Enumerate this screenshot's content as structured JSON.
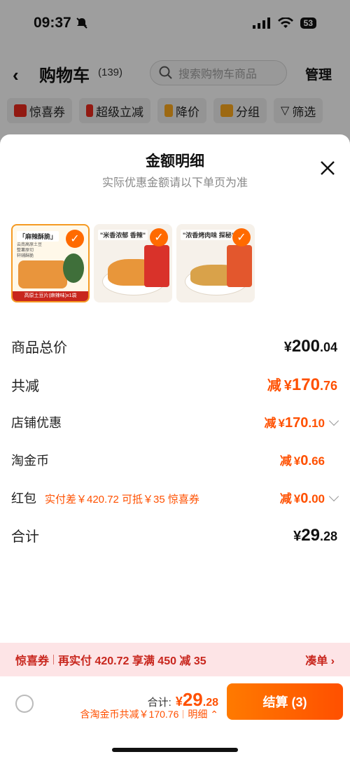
{
  "status": {
    "time": "09:37",
    "battery": "53"
  },
  "header": {
    "title": "购物车",
    "count": "(139)",
    "search_placeholder": "搜索购物车商品",
    "manage": "管理"
  },
  "chips": [
    "惊喜券",
    "超级立减",
    "降价",
    "分组",
    "筛选"
  ],
  "sheet": {
    "title": "金额明细",
    "subtitle": "实际优惠金额请以下单页为准",
    "products": [
      {
        "name": "「麻辣酥脆」",
        "line1": "云南高原土豆",
        "line2": "整薯原切",
        "line3": "轩辅酥脆",
        "bar": "高原土豆片(麻辣味)x1袋"
      },
      {
        "name": "\"米香浓郁 香辣\""
      },
      {
        "name": "\"浓香烤肉味 探秘\""
      }
    ],
    "rows": {
      "subtotal_label": "商品总价",
      "subtotal_cur": "¥",
      "subtotal_int": "200",
      "subtotal_dec": ".04",
      "reduce_label": "共减",
      "reduce_prefix": "减",
      "reduce_cur": "¥",
      "reduce_int": "170",
      "reduce_dec": ".76",
      "shop_label": "店铺优惠",
      "shop_prefix": "减",
      "shop_cur": "¥",
      "shop_int": "170",
      "shop_dec": ".10",
      "coin_label": "淘金币",
      "coin_prefix": "减",
      "coin_cur": "¥",
      "coin_int": "0",
      "coin_dec": ".66",
      "hongbao_label": "红包",
      "hongbao_note": "实付差￥420.72 可抵￥35 惊喜券",
      "hongbao_prefix": "减",
      "hongbao_cur": "¥",
      "hongbao_int": "0",
      "hongbao_dec": ".00",
      "total_label": "合计",
      "total_cur": "¥",
      "total_int": "29",
      "total_dec": ".28"
    }
  },
  "promo": {
    "tag": "惊喜券",
    "text": "再实付 420.72 享满 450 减 35",
    "action": "凑单"
  },
  "bottom": {
    "total_label": "合计:",
    "total_cur": "¥",
    "total_int": "29",
    "total_dec": ".28",
    "sub_text": "含淘金币共减￥170.76",
    "detail": "明细",
    "checkout": "结算 (3)"
  }
}
